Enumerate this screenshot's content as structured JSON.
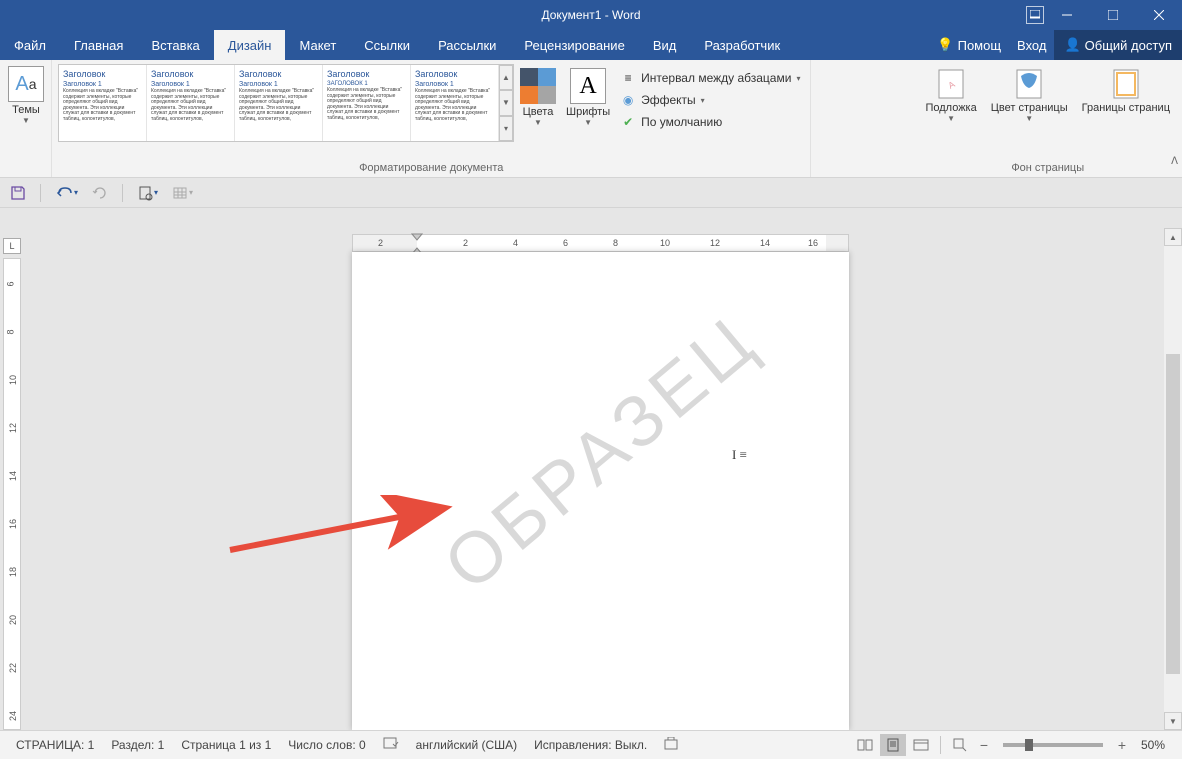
{
  "title": "Документ1 - Word",
  "menu": {
    "file": "Файл",
    "home": "Главная",
    "insert": "Вставка",
    "design": "Дизайн",
    "layout": "Макет",
    "references": "Ссылки",
    "mailings": "Рассылки",
    "review": "Рецензирование",
    "view": "Вид",
    "developer": "Разработчик",
    "tell_me": "Помощ",
    "sign_in": "Вход",
    "share": "Общий доступ"
  },
  "ribbon": {
    "themes": "Темы",
    "style_heading": "Заголовок",
    "style_sub": "Заголовок 1",
    "style_body": "Коллекция на вкладке \"Вставка\" содержит элементы, которые определяют общий вид документа. Эти коллекции служат для вставки в документ таблиц, колонтитулов,",
    "doc_formatting_label": "Форматирование документа",
    "colors": "Цвета",
    "fonts": "Шрифты",
    "paragraph_spacing": "Интервал между абзацами",
    "effects": "Эффекты",
    "set_default": "По умолчанию",
    "watermark_btn": "Подложка",
    "page_color": "Цвет страницы",
    "page_borders": "Границы страниц",
    "page_bg_label": "Фон страницы"
  },
  "ruler": {
    "marks": [
      "2",
      "2",
      "4",
      "6",
      "8",
      "10",
      "12",
      "14",
      "16"
    ]
  },
  "vruler": [
    "6",
    "8",
    "10",
    "12",
    "14",
    "16",
    "18",
    "20",
    "22",
    "24"
  ],
  "watermark_text": "ОБРАЗЕЦ",
  "status": {
    "page": "СТРАНИЦА: 1",
    "section": "Раздел: 1",
    "page_of": "Страница 1 из 1",
    "words": "Число слов: 0",
    "language": "английский (США)",
    "track": "Исправления: Выкл.",
    "zoom": "50%"
  }
}
